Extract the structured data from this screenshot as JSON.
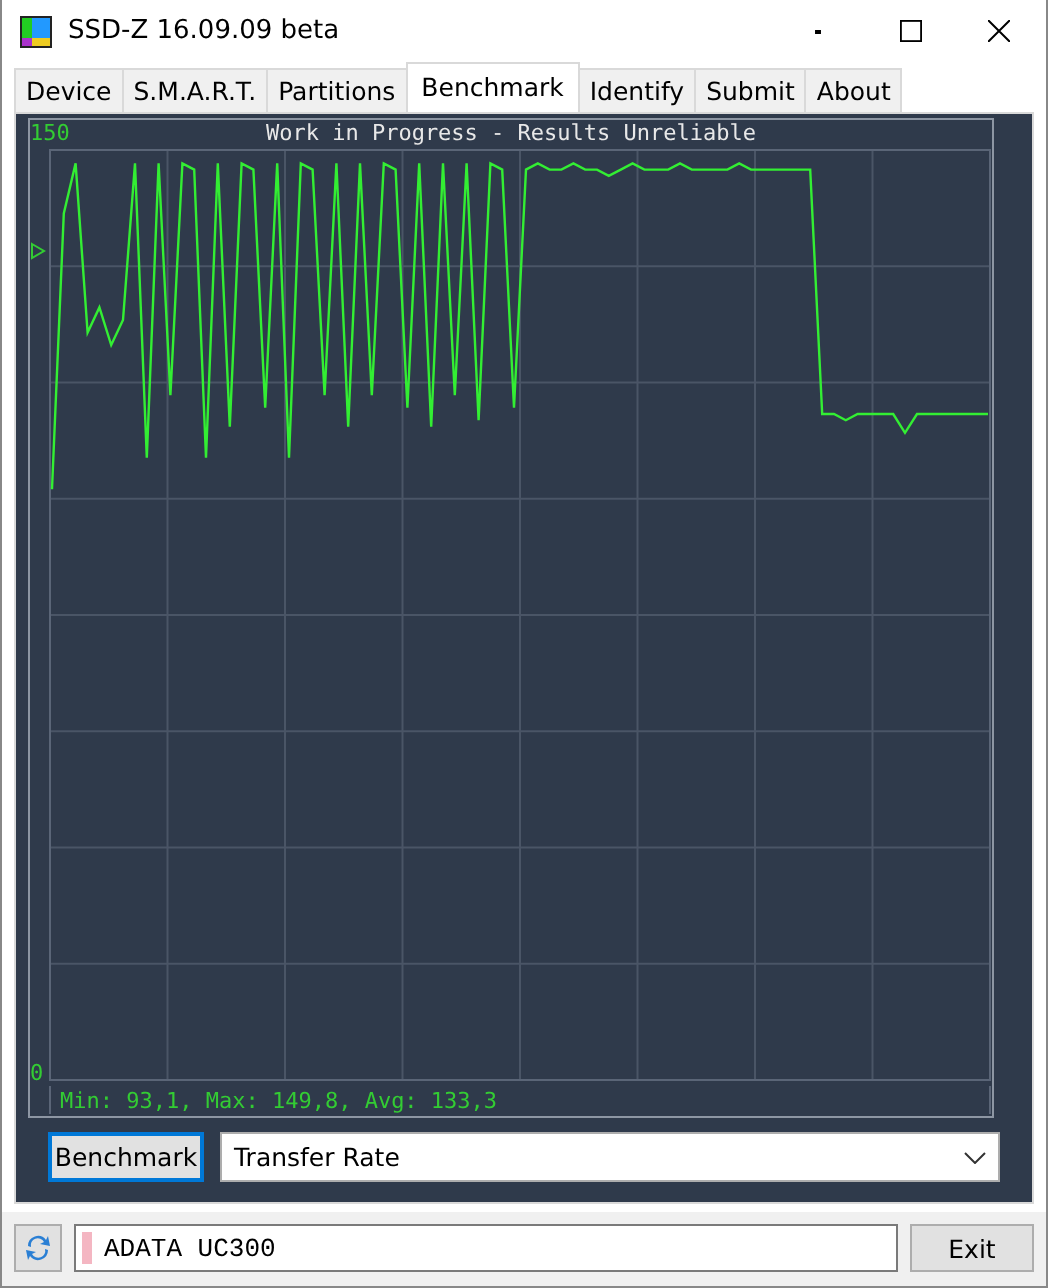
{
  "window": {
    "title": "SSD-Z 16.09.09 beta"
  },
  "tabs": [
    {
      "label": "Device",
      "selected": false
    },
    {
      "label": "S.M.A.R.T.",
      "selected": false
    },
    {
      "label": "Partitions",
      "selected": false
    },
    {
      "label": "Benchmark",
      "selected": true
    },
    {
      "label": "Identify",
      "selected": false
    },
    {
      "label": "Submit",
      "selected": false
    },
    {
      "label": "About",
      "selected": false
    }
  ],
  "chart": {
    "chart_data": {
      "type": "line",
      "title": "Work in Progress - Results Unreliable",
      "ylim": [
        0,
        150
      ],
      "yticks": [
        0,
        150
      ],
      "series": [
        {
          "color": "#33ee33",
          "values": [
            93,
            137,
            145,
            118,
            122,
            116,
            120,
            145,
            98,
            145,
            108,
            145,
            144,
            98,
            145,
            103,
            145,
            144,
            106,
            145,
            98,
            145,
            144,
            108,
            145,
            103,
            145,
            108,
            145,
            144,
            106,
            145,
            103,
            145,
            108,
            145,
            104,
            145,
            144,
            106,
            144,
            145,
            144,
            144,
            145,
            144,
            144,
            143,
            144,
            145,
            144,
            144,
            144,
            145,
            144,
            144,
            144,
            144,
            145,
            144,
            144,
            144,
            144,
            144,
            144,
            105,
            105,
            104,
            105,
            105,
            105,
            105,
            102,
            105,
            105,
            105,
            105,
            105,
            105,
            105
          ]
        }
      ]
    },
    "stats": "Min: 93,1, Max: 149,8, Avg: 133,3"
  },
  "benchmark_button": "Benchmark",
  "mode_select": {
    "value": "Transfer Rate"
  },
  "drive_field": {
    "value": "ADATA UC300"
  },
  "exit_button": "Exit"
}
